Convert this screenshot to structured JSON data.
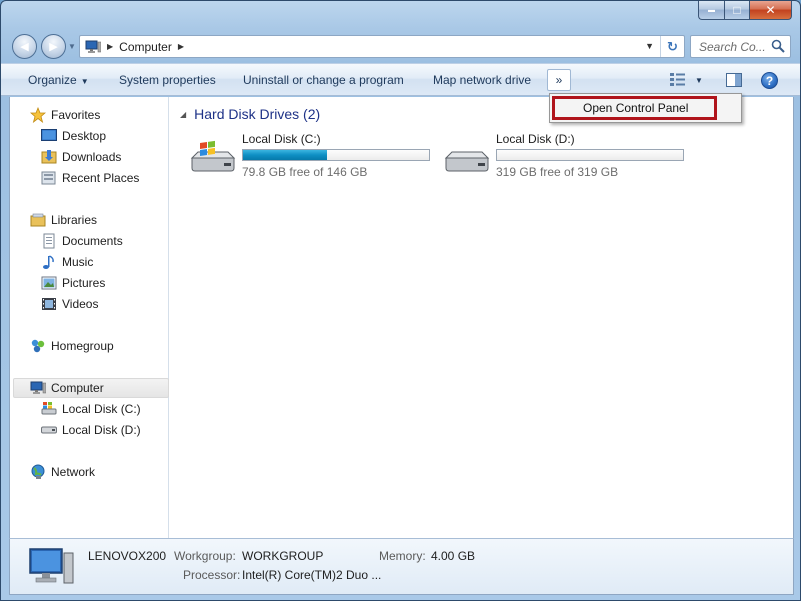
{
  "window": {
    "caption_buttons": {
      "minimize": "▬",
      "maximize": "□",
      "close": "✕"
    }
  },
  "nav": {
    "back": "◀",
    "forward": "▶",
    "recent_dropdown": "▼",
    "address": {
      "crumb": "Computer",
      "dropdown": "▼",
      "refresh": "↻"
    },
    "search": {
      "placeholder": "Search Co..."
    }
  },
  "toolbar": {
    "organize": "Organize",
    "system_properties": "System properties",
    "uninstall": "Uninstall or change a program",
    "map_network_drive": "Map network drive",
    "more": "»",
    "help": "?"
  },
  "overflow_menu": {
    "items": [
      {
        "label": "Open Control Panel"
      }
    ]
  },
  "sidebar": {
    "favorites": {
      "label": "Favorites",
      "items": [
        {
          "label": "Desktop"
        },
        {
          "label": "Downloads"
        },
        {
          "label": "Recent Places"
        }
      ]
    },
    "libraries": {
      "label": "Libraries",
      "items": [
        {
          "label": "Documents"
        },
        {
          "label": "Music"
        },
        {
          "label": "Pictures"
        },
        {
          "label": "Videos"
        }
      ]
    },
    "homegroup": {
      "label": "Homegroup"
    },
    "computer": {
      "label": "Computer",
      "items": [
        {
          "label": "Local Disk (C:)"
        },
        {
          "label": "Local Disk (D:)"
        }
      ]
    },
    "network": {
      "label": "Network"
    }
  },
  "main": {
    "group_header": "Hard Disk Drives (2)",
    "drives": [
      {
        "name": "Local Disk (C:)",
        "free_text": "79.8 GB free of 146 GB",
        "used_fraction": 0.45
      },
      {
        "name": "Local Disk (D:)",
        "free_text": "319 GB free of 319 GB",
        "used_fraction": 0.0
      }
    ]
  },
  "details": {
    "computer_name": "LENOVOX200",
    "workgroup_label": "Workgroup:",
    "workgroup_value": "WORKGROUP",
    "memory_label": "Memory:",
    "memory_value": "4.00 GB",
    "processor_label": "Processor:",
    "processor_value": "Intel(R) Core(TM)2 Duo ..."
  },
  "colors": {
    "drive_fill": "#0f8fc4",
    "highlight_box": "#b0141b",
    "group_header": "#1e3287",
    "toolbar_text": "#1e395b"
  }
}
